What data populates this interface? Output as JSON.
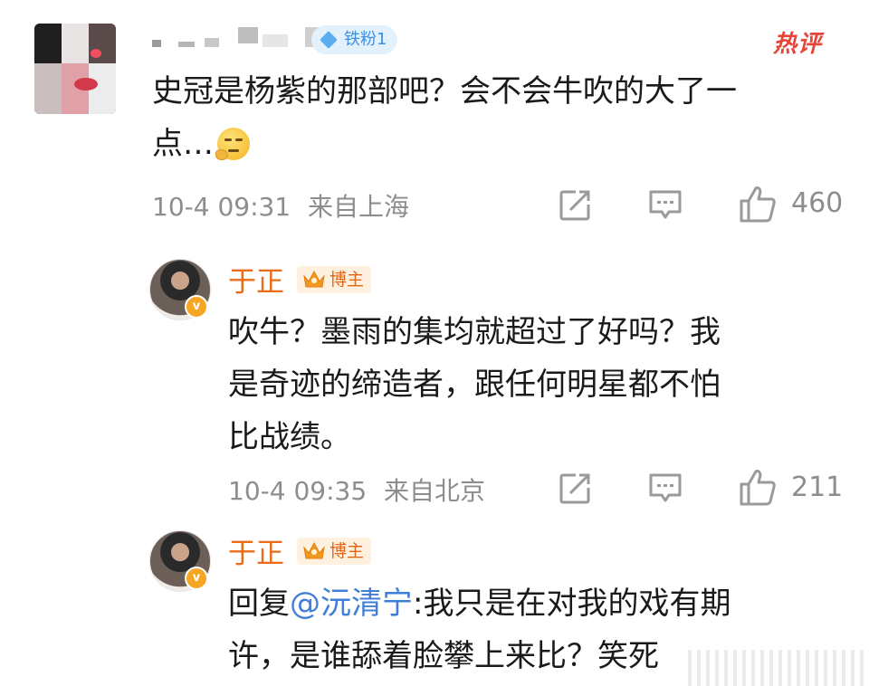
{
  "comment": {
    "fan_badge": "铁粉1",
    "hot_tag": "热评",
    "text_line1": "史冠是杨紫的那部吧？会不会牛吹的大了一",
    "text_line2": "点…",
    "emoji": "thinking-face",
    "timestamp": "10-4 09:31",
    "location": "来自上海",
    "like_count": "460"
  },
  "replies": [
    {
      "username": "于正",
      "badge": "博主",
      "text_lines": [
        "吹牛？墨雨的集均就超过了好吗？我",
        "是奇迹的缔造者，跟任何明星都不怕",
        "比战绩。"
      ],
      "timestamp": "10-4 09:35",
      "location": "来自北京",
      "like_count": "211"
    },
    {
      "username": "于正",
      "badge": "博主",
      "reply_prefix": "回复",
      "mention": "@沅清宁",
      "text_after_mention": ":我只是在对我的戏有期",
      "text_line2": "许，是谁舔着脸攀上来比？笑死"
    }
  ],
  "colors": {
    "username": "#ec6b18",
    "hot_tag": "#e8443a",
    "fan_badge": "#3d8fe0",
    "mention": "#3f7fd8",
    "meta": "#8d8d8d"
  },
  "icons": {
    "share": "share-square-arrow-icon",
    "comment": "comment-bubble-icon",
    "like": "thumbs-up-icon"
  }
}
